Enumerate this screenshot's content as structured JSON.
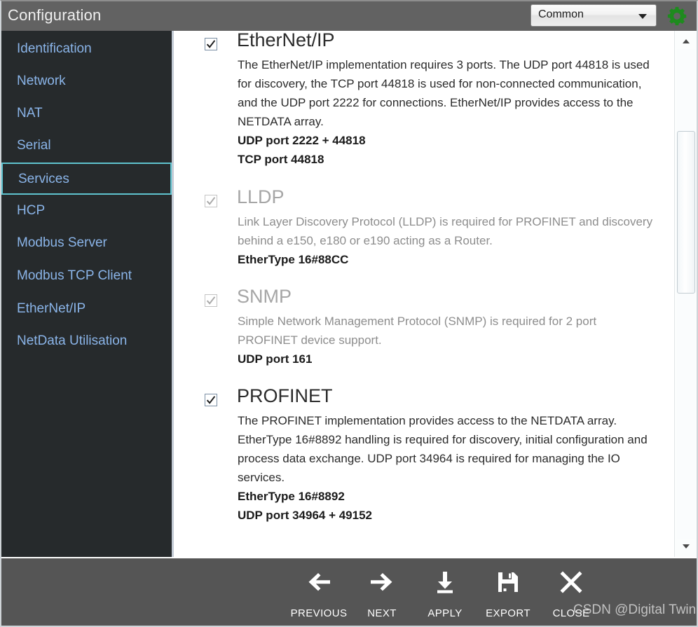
{
  "window": {
    "title": "Configuration",
    "watermark": "CSDN @Digital Twin"
  },
  "header": {
    "profile_selected": "Common",
    "gear_icon": "gear-icon",
    "gear_color": "#1e8b1e"
  },
  "sidebar": {
    "items": [
      {
        "label": "Identification",
        "selected": false
      },
      {
        "label": "Network",
        "selected": false
      },
      {
        "label": "NAT",
        "selected": false
      },
      {
        "label": "Serial",
        "selected": false
      },
      {
        "label": "Services",
        "selected": true
      },
      {
        "label": "HCP",
        "selected": false
      },
      {
        "label": "Modbus Server",
        "selected": false
      },
      {
        "label": "Modbus TCP Client",
        "selected": false
      },
      {
        "label": "EtherNet/IP",
        "selected": false
      },
      {
        "label": "NetData Utilisation",
        "selected": false
      }
    ],
    "selected_border_color": "#5fc3cf",
    "text_color": "#8ab4e8"
  },
  "services": [
    {
      "name": "EtherNet/IP",
      "checked": true,
      "enabled": true,
      "description": "The EtherNet/IP implementation requires 3 ports. The UDP port 44818 is used for discovery, the TCP port 44818 is used for non-connected communication, and the UDP port 2222 for connections. EtherNet/IP provides access to the NETDATA array.",
      "ports": [
        "UDP port 2222 + 44818",
        "TCP port 44818"
      ]
    },
    {
      "name": "LLDP",
      "checked": true,
      "enabled": false,
      "description": "Link Layer Discovery Protocol (LLDP) is required for PROFINET and discovery behind a e150, e180 or e190 acting as a Router.",
      "ports": [
        "EtherType 16#88CC"
      ]
    },
    {
      "name": "SNMP",
      "checked": true,
      "enabled": false,
      "description": "Simple Network Management Protocol (SNMP) is required for 2 port PROFINET device support.",
      "ports": [
        "UDP port 161"
      ]
    },
    {
      "name": "PROFINET",
      "checked": true,
      "enabled": true,
      "description": "The PROFINET implementation provides access to the NETDATA array. EtherType 16#8892 handling is required for discovery, initial configuration and process data exchange. UDP port 34964 is required for managing the IO services.",
      "ports": [
        "EtherType 16#8892",
        "UDP port 34964 + 49152"
      ]
    }
  ],
  "scrollbar": {
    "up_icon": "scroll-up-arrow-icon",
    "down_icon": "scroll-down-arrow-icon"
  },
  "footer": {
    "buttons": [
      {
        "label": "PREVIOUS",
        "icon": "arrow-left-icon"
      },
      {
        "label": "NEXT",
        "icon": "arrow-right-icon"
      },
      {
        "label": "APPLY",
        "icon": "download-icon"
      },
      {
        "label": "EXPORT",
        "icon": "save-floppy-icon"
      },
      {
        "label": "CLOSE",
        "icon": "close-x-icon"
      }
    ]
  }
}
